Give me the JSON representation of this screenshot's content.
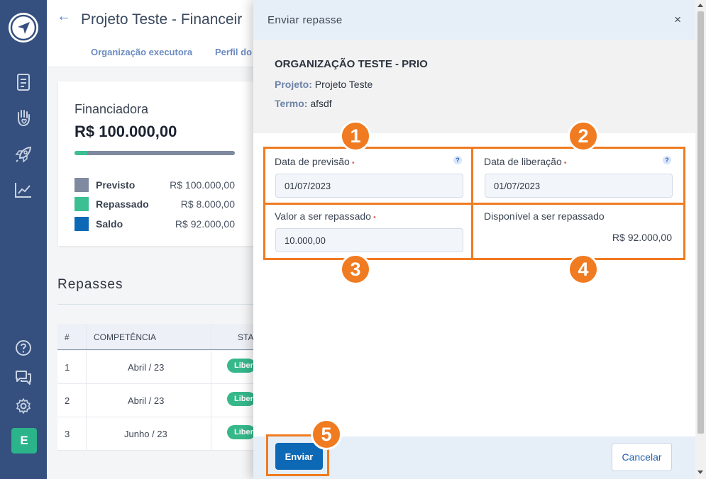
{
  "app": {
    "avatar_letter": "E"
  },
  "sidebar": {
    "icons": [
      "logo-icon",
      "document-icon",
      "hand-heart-icon",
      "rocket-icon",
      "chart-icon",
      "help-icon",
      "chat-icon",
      "gear-icon"
    ]
  },
  "header": {
    "title": "Projeto Teste - Financeir",
    "tabs": [
      "Organização executora",
      "Perfil do"
    ]
  },
  "card": {
    "title": "Financiadora",
    "amount": "R$ 100.000,00",
    "progress_fraction": 0.08,
    "legend": [
      {
        "label": "Previsto",
        "value": "R$ 100.000,00",
        "color": "#7f8aa0"
      },
      {
        "label": "Repassado",
        "value": "R$ 8.000,00",
        "color": "#3bbf93"
      },
      {
        "label": "Saldo",
        "value": "R$ 92.000,00",
        "color": "#0d69b5"
      }
    ]
  },
  "repasses": {
    "title": "Repasses",
    "columns": [
      "#",
      "COMPETÊNCIA",
      "STA"
    ],
    "rows": [
      {
        "num": "1",
        "competencia": "Abril / 23",
        "status": "Liber"
      },
      {
        "num": "2",
        "competencia": "Abril / 23",
        "status": "Liber"
      },
      {
        "num": "3",
        "competencia": "Junho / 23",
        "status": "Liber"
      }
    ]
  },
  "modal": {
    "title": "Enviar repasse",
    "close": "×",
    "org_name": "ORGANIZAÇÃO TESTE - PRIO",
    "projeto_label": "Projeto:",
    "projeto_value": "Projeto Teste",
    "termo_label": "Termo:",
    "termo_value": "afsdf",
    "fields": {
      "previsao_label": "Data de previsão",
      "previsao_value": "01/07/2023",
      "liberacao_label": "Data de liberação",
      "liberacao_value": "01/07/2023",
      "valor_label": "Valor a ser repassado",
      "valor_value": "10.000,00",
      "disponivel_label": "Disponível a ser repassado",
      "disponivel_value": "R$ 92.000,00"
    },
    "required_mark": "•",
    "help_mark": "?",
    "submit": "Enviar",
    "cancel": "Cancelar"
  },
  "annotations": {
    "color": "#f07b20",
    "labels": [
      "1",
      "2",
      "3",
      "4",
      "5"
    ]
  }
}
